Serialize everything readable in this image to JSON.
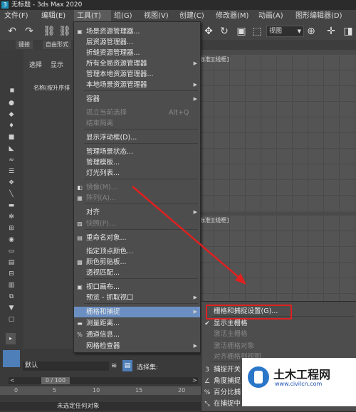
{
  "window": {
    "title": "无标题 - 3ds Max 2020",
    "app_icon": "3"
  },
  "menubar": {
    "items": [
      "文件(F)",
      "编辑(E)",
      "工具(T)",
      "组(G)",
      "视图(V)",
      "创建(C)",
      "修改器(M)",
      "动画(A)",
      "图形编辑器(D)"
    ]
  },
  "toolbar": {
    "view_dropdown": "视图"
  },
  "subbar": {
    "tab1": "键接",
    "tab2": "自由形式"
  },
  "scene_panel": {
    "tab_select": "选择",
    "tab_display": "显示",
    "name_header": "名称(按升序排"
  },
  "viewports": {
    "top_left_label": "标准][线框]",
    "mid_label": "标准][线框]"
  },
  "tools_menu": {
    "items": [
      {
        "label": "场景资源管理器...",
        "icon": "explorer-icon",
        "glyph": "▣"
      },
      {
        "label": "层资源管理器...",
        "icon": "",
        "glyph": ""
      },
      {
        "label": "折缝资源管理器...",
        "icon": "",
        "glyph": ""
      },
      {
        "label": "所有全局资源管理器",
        "icon": "",
        "glyph": "",
        "submenu": true
      },
      {
        "label": "管理本地资源管理器...",
        "icon": "",
        "glyph": ""
      },
      {
        "label": "本地场景资源管理器",
        "icon": "",
        "glyph": "",
        "submenu": true
      },
      {
        "label": "容器",
        "icon": "",
        "glyph": "",
        "submenu": true
      },
      {
        "label": "孤立当前选择",
        "shortcut": "Alt+Q",
        "disabled": true
      },
      {
        "label": "结束隔离",
        "disabled": true
      },
      {
        "label": "显示浮动框(D)..."
      },
      {
        "label": "管理场景状态..."
      },
      {
        "label": "管理模板..."
      },
      {
        "label": "灯光列表..."
      },
      {
        "label": "镜像(M)...",
        "disabled": true,
        "icon": "mirror-icon",
        "glyph": "◧"
      },
      {
        "label": "阵列(A)...",
        "disabled": true,
        "icon": "array-icon",
        "glyph": "▦"
      },
      {
        "label": "对齐",
        "submenu": true
      },
      {
        "label": "快照(P)...",
        "disabled": true,
        "icon": "snapshot-icon",
        "glyph": "▨"
      },
      {
        "label": "重命名对象...",
        "icon": "rename-icon",
        "glyph": "▤"
      },
      {
        "label": "指定顶点颜色..."
      },
      {
        "label": "颜色剪贴板...",
        "icon": "color-clipboard-icon",
        "glyph": "▩"
      },
      {
        "label": "透视匹配..."
      },
      {
        "label": "视口画布...",
        "icon": "canvas-icon",
        "glyph": "▣"
      },
      {
        "label": "预览 - 抓取视口",
        "submenu": true
      },
      {
        "label": "栅格和捕捉",
        "submenu": true,
        "highlighted": true
      },
      {
        "label": "测量距离...",
        "icon": "measure-icon",
        "glyph": "▬"
      },
      {
        "label": "通道信息...",
        "icon": "channel-icon",
        "glyph": "%"
      },
      {
        "label": "网格检查器",
        "submenu": true
      }
    ]
  },
  "grid_submenu": {
    "items": [
      {
        "label": "栅格和捕捉设置(G)...",
        "icon": "",
        "glyph": ""
      },
      {
        "label": "显示主栅格",
        "icon": "check-icon",
        "glyph": "✔"
      },
      {
        "label": "激活主栅格",
        "disabled": true
      },
      {
        "label": "激活栅格对象",
        "disabled": true
      },
      {
        "label": "对齐栅格到视图",
        "disabled": true
      },
      {
        "label": "捕捉开关",
        "icon": "snap-3-icon",
        "glyph": "3"
      },
      {
        "label": "角度捕捉",
        "icon": "angle-snap-icon",
        "glyph": "∠"
      },
      {
        "label": "百分比捕",
        "icon": "percent-snap-icon",
        "glyph": "%"
      },
      {
        "label": "在捕捉中",
        "icon": "snap-in-icon",
        "glyph": "⤡"
      }
    ]
  },
  "bottom": {
    "default_label": "默认",
    "selection_set": "选择集:",
    "frame_counter": "0 / 100",
    "ticks": [
      "0",
      "5",
      "10",
      "15",
      "20"
    ],
    "status": "未选定任何对象"
  },
  "watermark": {
    "name": "土木工程网",
    "url": "www.civilcn.com"
  },
  "colors": {
    "menu_bg": "#4d4d4d",
    "highlight": "#6b8fc2",
    "annotation": "#e02020"
  }
}
